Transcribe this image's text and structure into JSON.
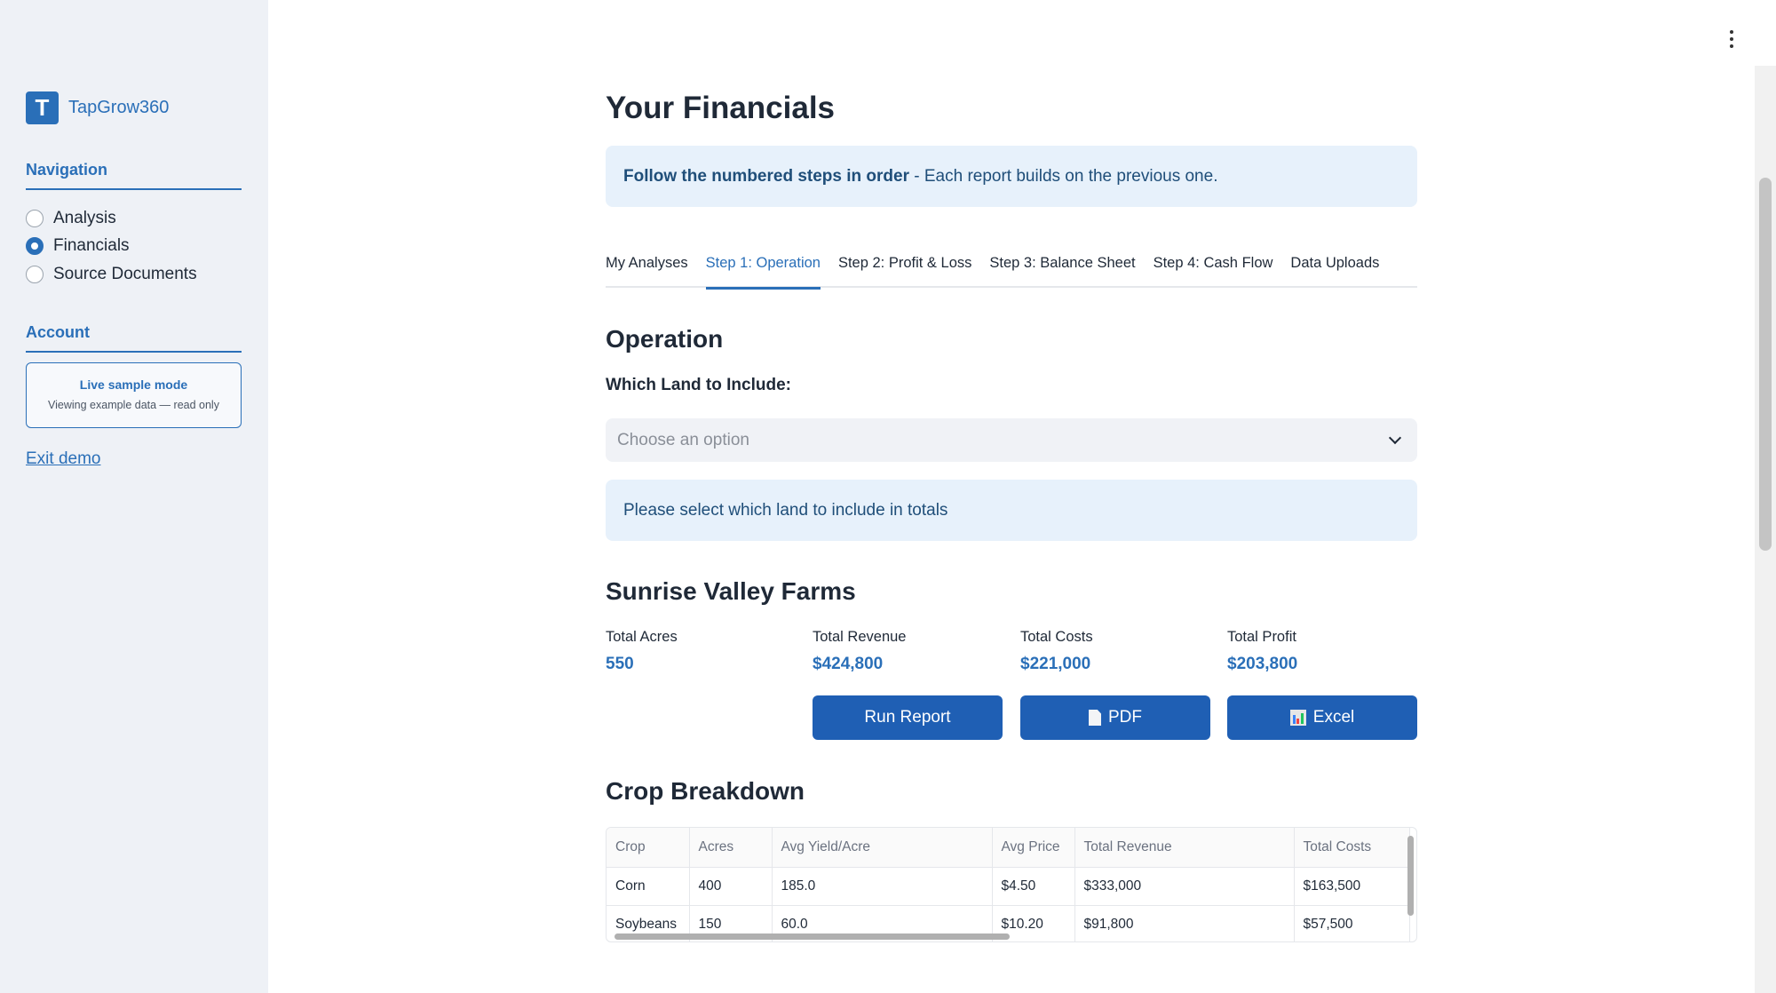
{
  "sidebar": {
    "brand": {
      "logo_letter": "T",
      "name": "TapGrow360"
    },
    "navigation_heading": "Navigation",
    "nav_items": [
      {
        "label": "Analysis",
        "selected": false
      },
      {
        "label": "Financials",
        "selected": true
      },
      {
        "label": "Source Documents",
        "selected": false
      }
    ],
    "account_heading": "Account",
    "sample_mode": {
      "title": "Live sample mode",
      "subtitle": "Viewing example data — read only"
    },
    "exit_link": "Exit demo"
  },
  "main": {
    "title": "Your Financials",
    "info_banner": {
      "bold": "Follow the numbered steps in order",
      "rest": " - Each report builds on the previous one."
    },
    "tabs": [
      {
        "label": "My Analyses",
        "active": false
      },
      {
        "label": "Step 1: Operation",
        "active": true
      },
      {
        "label": "Step 2: Profit & Loss",
        "active": false
      },
      {
        "label": "Step 3: Balance Sheet",
        "active": false
      },
      {
        "label": "Step 4: Cash Flow",
        "active": false
      },
      {
        "label": "Data Uploads",
        "active": false
      }
    ],
    "operation_heading": "Operation",
    "land_label": "Which Land to Include:",
    "land_select_placeholder": "Choose an option",
    "land_notice": "Please select which land to include in totals",
    "farm_name": "Sunrise Valley Farms",
    "metrics": [
      {
        "label": "Total Acres",
        "value": "550"
      },
      {
        "label": "Total Revenue",
        "value": "$424,800"
      },
      {
        "label": "Total Costs",
        "value": "$221,000"
      },
      {
        "label": "Total Profit",
        "value": "$203,800"
      }
    ],
    "buttons": {
      "run_report": "Run Report",
      "pdf": "PDF",
      "excel": "Excel"
    },
    "crop_heading": "Crop Breakdown",
    "crop_table": {
      "columns": [
        "Crop",
        "Acres",
        "Avg Yield/Acre",
        "Avg Price",
        "Total Revenue",
        "Total Costs"
      ],
      "rows": [
        [
          "Corn",
          "400",
          "185.0",
          "$4.50",
          "$333,000",
          "$163,500"
        ],
        [
          "Soybeans",
          "150",
          "60.0",
          "$10.20",
          "$91,800",
          "$57,500"
        ]
      ]
    }
  },
  "colors": {
    "accent": "#2a6fb8",
    "button": "#1f5fb4",
    "info_bg": "#e7f1fb",
    "sidebar_bg": "#eef1f6"
  },
  "icons": {
    "menu": "kebab-menu-icon",
    "pdf": "document-icon",
    "excel": "bar-chart-icon",
    "select": "chevron-down-icon"
  }
}
